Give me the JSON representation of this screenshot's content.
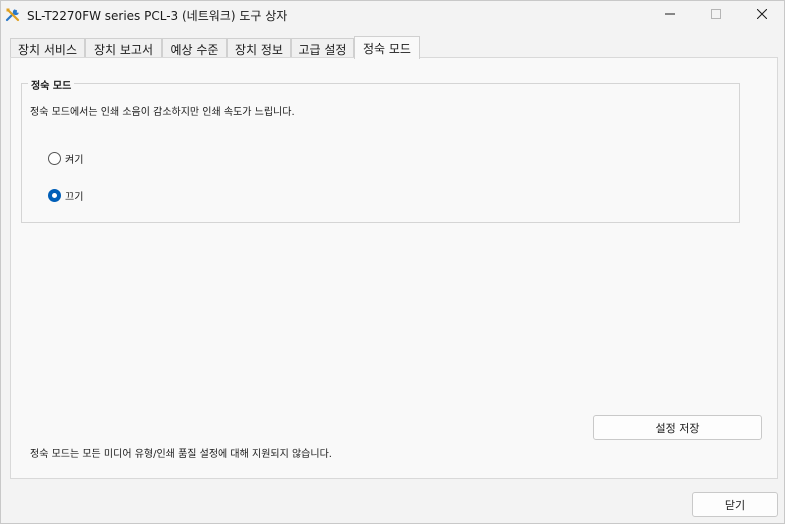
{
  "window": {
    "title": "SL-T2270FW series PCL-3 (네트워크) 도구 상자",
    "app_icon": "tools-icon",
    "controls": [
      "minimize-icon",
      "maximize-icon",
      "close-icon"
    ]
  },
  "tabs": [
    {
      "label": "장치 서비스",
      "active": false
    },
    {
      "label": "장치 보고서",
      "active": false
    },
    {
      "label": "예상 수준",
      "active": false
    },
    {
      "label": "장치 정보",
      "active": false
    },
    {
      "label": "고급 설정",
      "active": false
    },
    {
      "label": "정숙 모드",
      "active": true
    }
  ],
  "quiet_mode": {
    "group_title": "정숙 모드",
    "description": "정숙 모드에서는 인쇄 소음이 감소하지만 인쇄 속도가 느립니다.",
    "options": [
      {
        "label": "켜기",
        "checked": false
      },
      {
        "label": "끄기",
        "checked": true
      }
    ],
    "save_label": "설정 저장",
    "footnote": "정숙 모드는 모든 미디어 유형/인쇄 품질 설정에 대해 지원되지 않습니다."
  },
  "footer": {
    "close_label": "닫기"
  },
  "colors": {
    "accent": "#005fb8",
    "window_bg": "#f3f3f3",
    "page_bg": "#f9f9f9"
  }
}
